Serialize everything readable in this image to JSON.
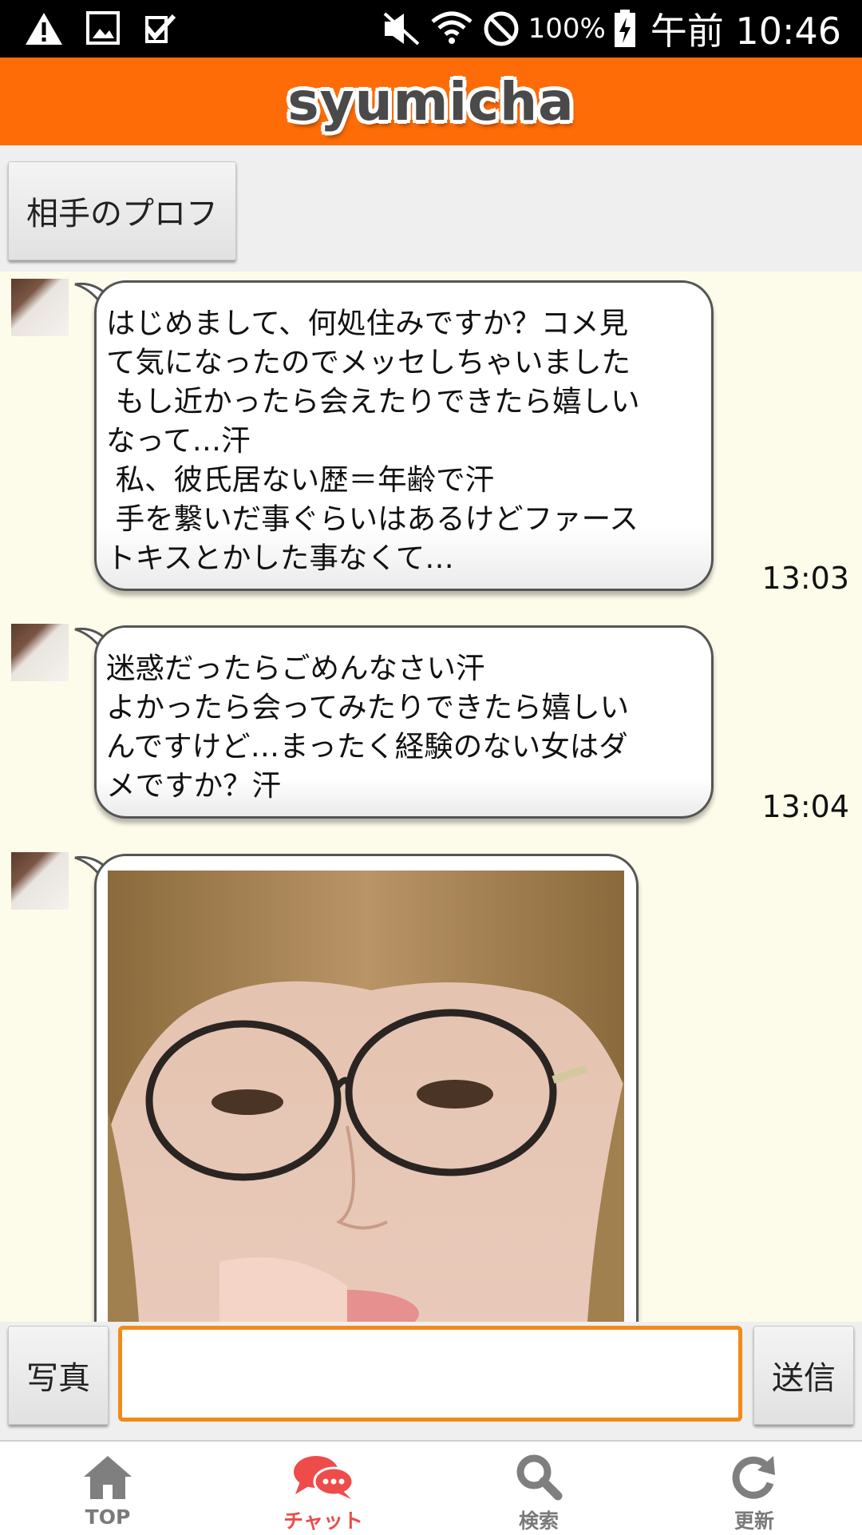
{
  "status_bar": {
    "left_icons": [
      "warning-icon",
      "image-icon",
      "checkbox-icon"
    ],
    "right_icons": [
      "mute-icon",
      "wifi-icon",
      "block-icon",
      "battery-charging-icon"
    ],
    "battery": "100%",
    "time": "午前 10:46"
  },
  "header": {
    "logo": "syumicha",
    "brand_color": "#fe6c08"
  },
  "profile_button": {
    "label": "相手のプロフ"
  },
  "messages": [
    {
      "lines": [
        "はじめまして、何処住みですか？コメ見",
        "て気になったのでメッセしちゃいました",
        " もし近かったら会えたりできたら嬉しい",
        "なって…汗",
        " 私、彼氏居ない歴＝年齢で汗",
        " 手を繋いだ事ぐらいはあるけどファース",
        "トキスとかした事なくて…"
      ],
      "time": "13:03"
    },
    {
      "lines": [
        "迷惑だったらごめんなさい汗",
        "よかったら会ってみたりできたら嬉しい",
        "んですけど…まったく経験のない女はダ",
        "メですか？汗"
      ],
      "time": "13:04"
    }
  ],
  "photo_message": {
    "type": "image"
  },
  "input_bar": {
    "photo_button": "写真",
    "send_button": "送信",
    "input_value": "",
    "accent_color": "#f28a18"
  },
  "bottom_nav": [
    {
      "label": "TOP",
      "icon": "home-icon",
      "active": false
    },
    {
      "label": "チャット",
      "icon": "chat-icon",
      "active": true
    },
    {
      "label": "検索",
      "icon": "search-icon",
      "active": false
    },
    {
      "label": "更新",
      "icon": "refresh-icon",
      "active": false
    }
  ]
}
